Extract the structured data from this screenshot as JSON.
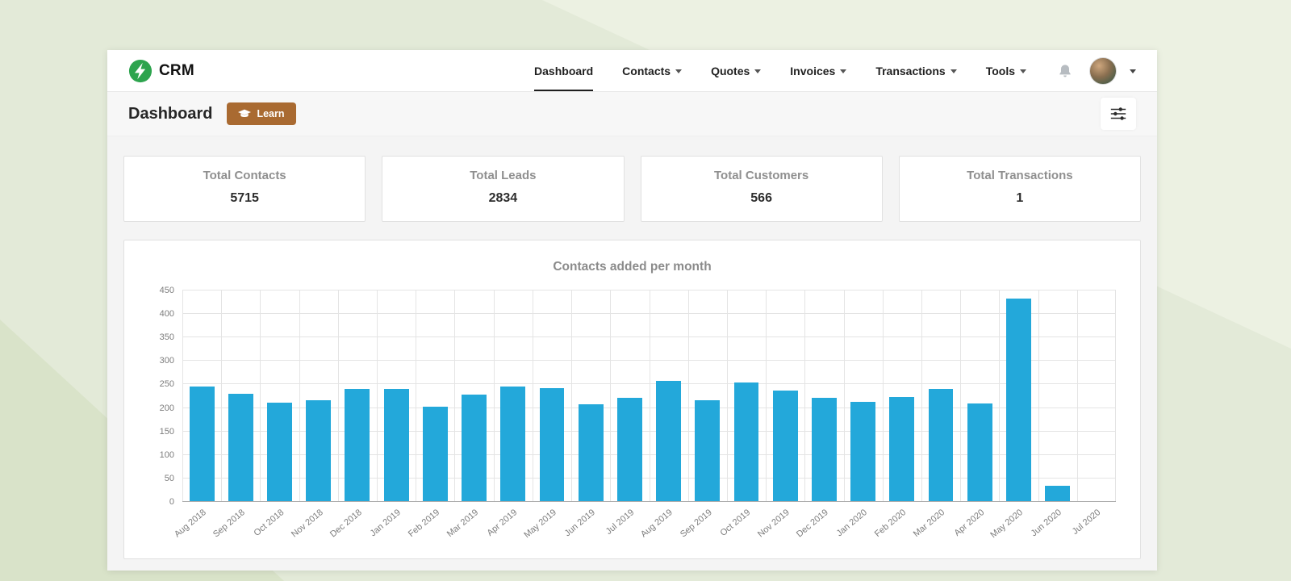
{
  "nav": {
    "brand": "CRM",
    "items": [
      {
        "label": "Dashboard"
      },
      {
        "label": "Contacts"
      },
      {
        "label": "Quotes"
      },
      {
        "label": "Invoices"
      },
      {
        "label": "Transactions"
      },
      {
        "label": "Tools"
      }
    ]
  },
  "header": {
    "title": "Dashboard",
    "learn_label": "Learn"
  },
  "stats": [
    {
      "label": "Total Contacts",
      "value": "5715"
    },
    {
      "label": "Total Leads",
      "value": "2834"
    },
    {
      "label": "Total Customers",
      "value": "566"
    },
    {
      "label": "Total Transactions",
      "value": "1"
    }
  ],
  "chart_data": {
    "type": "bar",
    "title": "Contacts added per month",
    "categories": [
      "Aug 2018",
      "Sep 2018",
      "Oct 2018",
      "Nov 2018",
      "Dec 2018",
      "Jan 2019",
      "Feb 2019",
      "Mar 2019",
      "Apr 2019",
      "May 2019",
      "Jun 2019",
      "Jul 2019",
      "Aug 2019",
      "Sep 2019",
      "Oct 2019",
      "Nov 2019",
      "Dec 2019",
      "Jan 2020",
      "Feb 2020",
      "Mar 2020",
      "Apr 2020",
      "May 2020",
      "Jun 2020",
      "Jul 2020"
    ],
    "values": [
      245,
      230,
      212,
      216,
      240,
      240,
      202,
      229,
      245,
      243,
      207,
      222,
      257,
      217,
      255,
      237,
      222,
      213,
      223,
      240,
      210,
      433,
      35,
      0
    ],
    "ylim": [
      0,
      450
    ],
    "ytick_step": 50,
    "grid": true,
    "bar_color": "#23a8da",
    "legend": "none",
    "xlabel": "",
    "ylabel": ""
  },
  "colors": {
    "accent_green": "#2da44e",
    "learn_brown": "#a96a31",
    "bar_blue": "#23a8da"
  }
}
